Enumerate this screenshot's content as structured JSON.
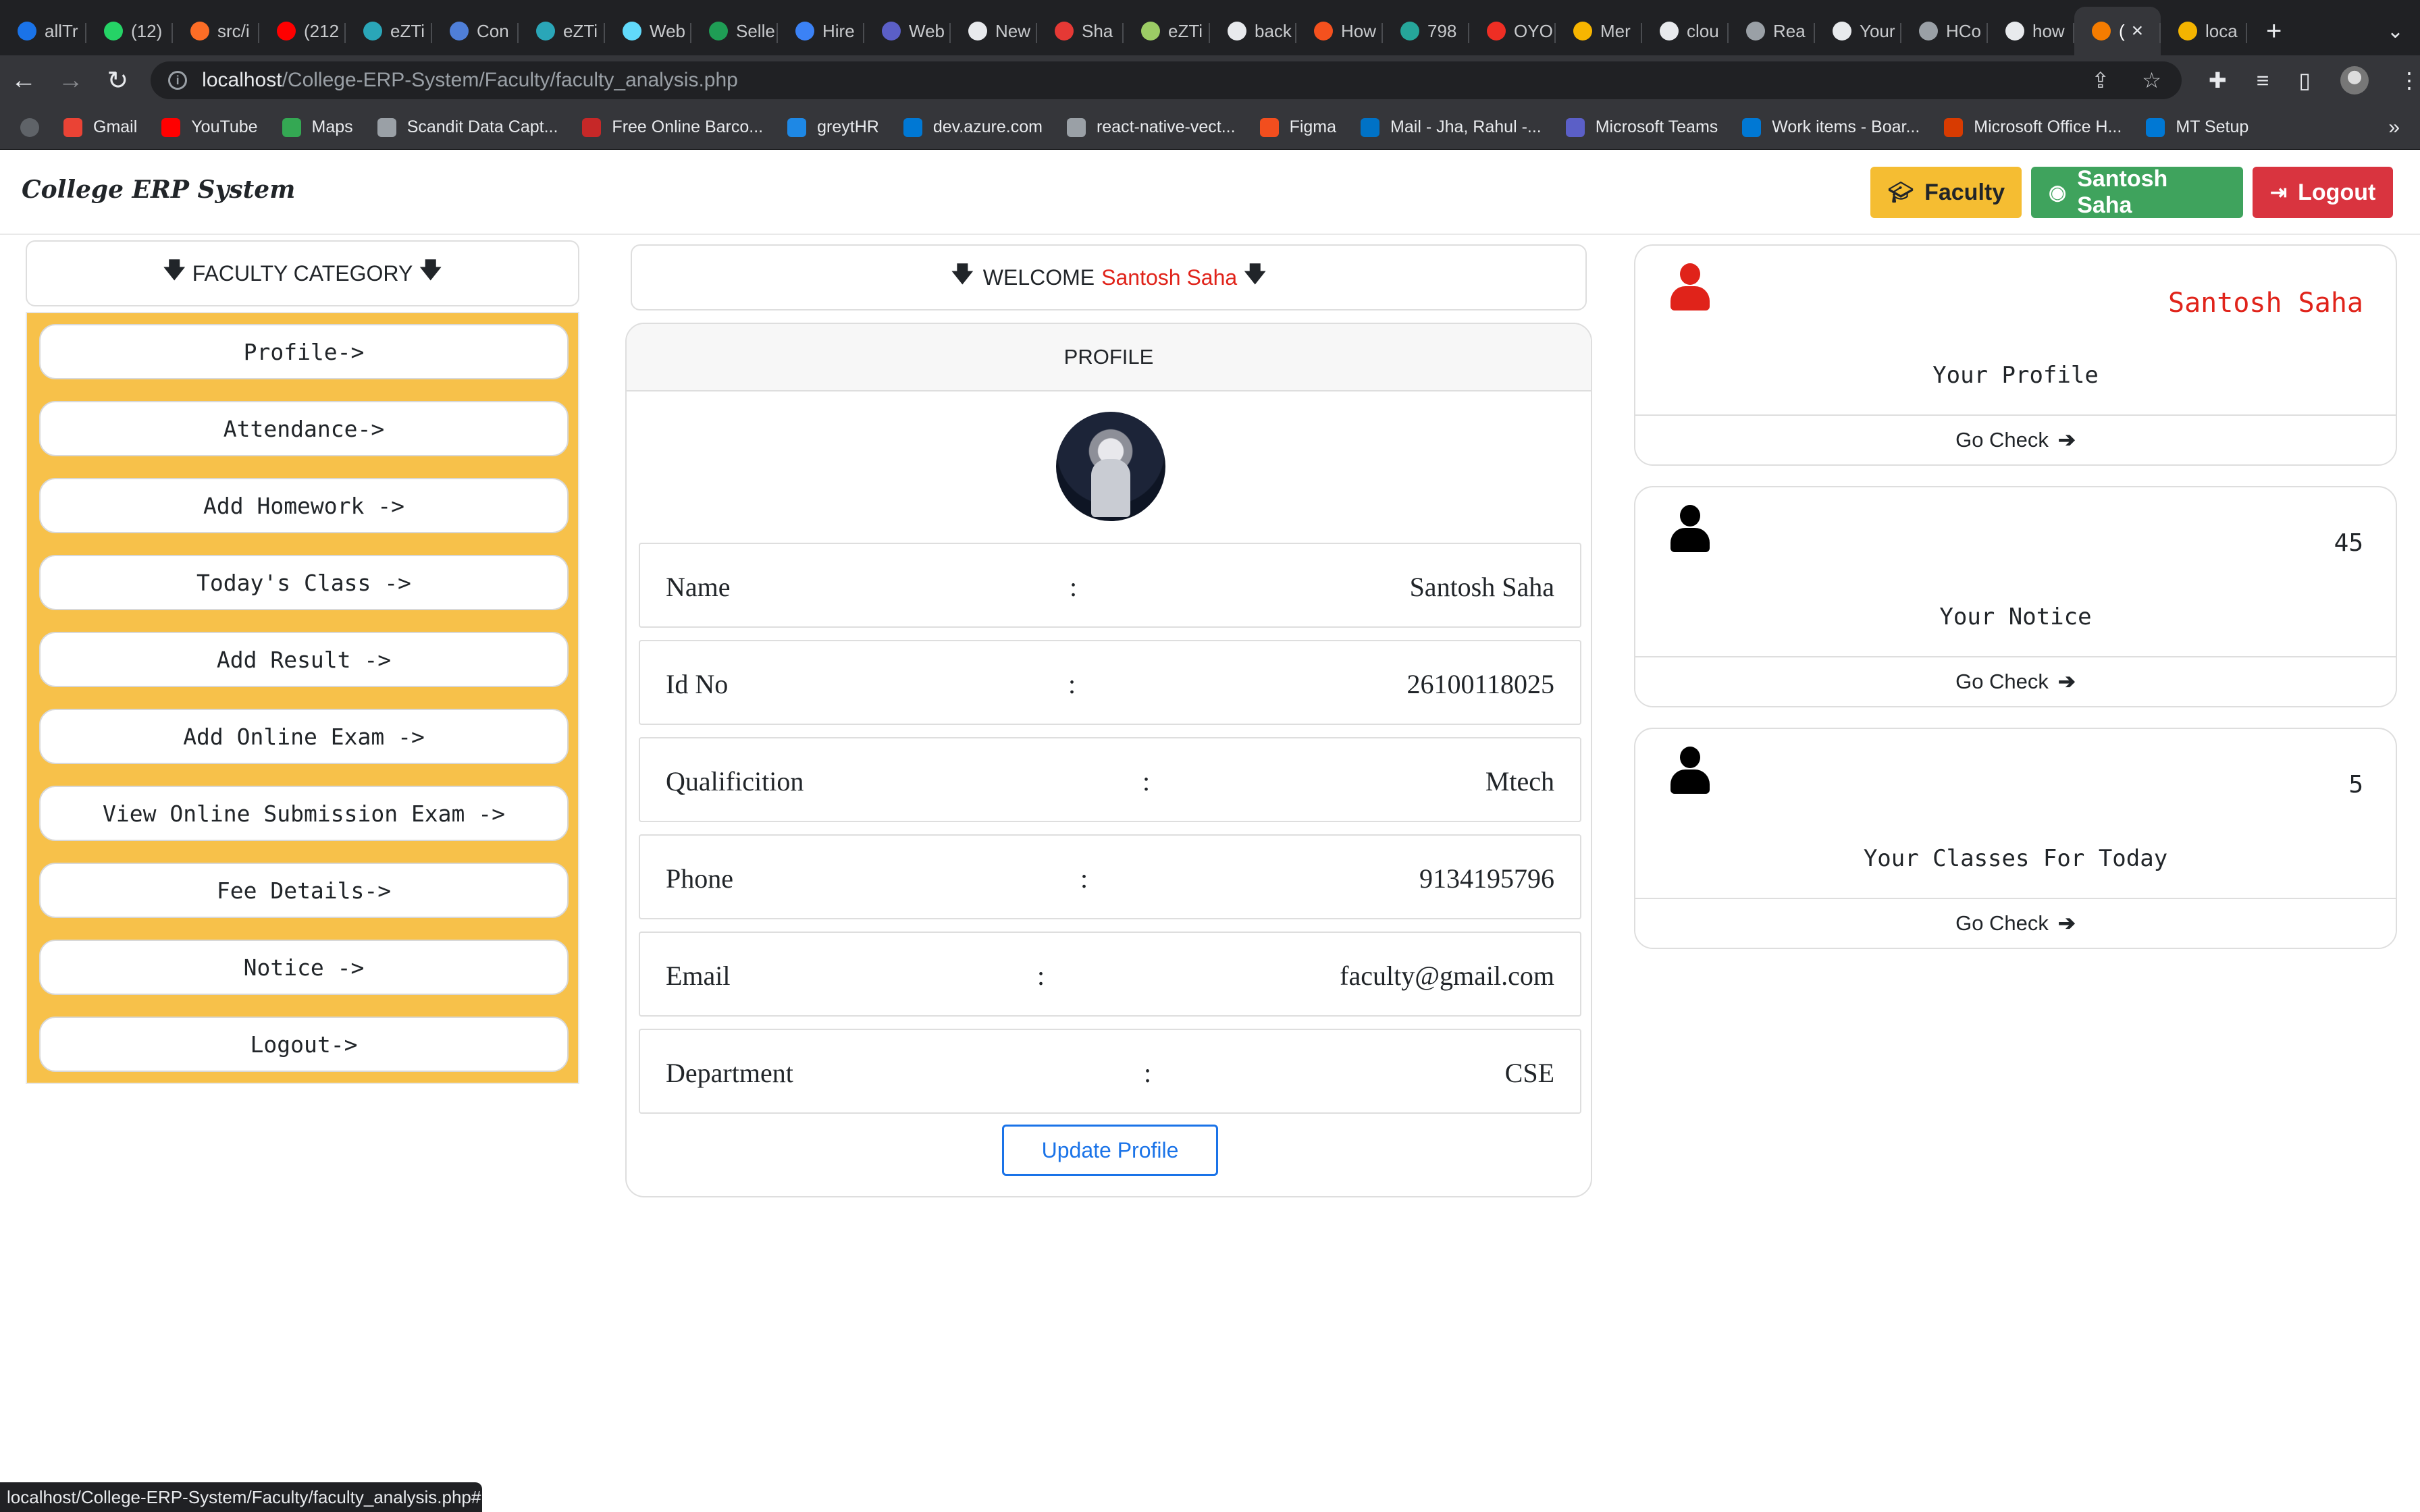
{
  "browser": {
    "tabs": [
      {
        "label": "allTr",
        "color": "#1a73e8"
      },
      {
        "label": "(12)",
        "color": "#25d366"
      },
      {
        "label": "src/i",
        "color": "#fc6d26"
      },
      {
        "label": "(212",
        "color": "#ff0000"
      },
      {
        "label": "eZTi",
        "color": "#2aa6b8"
      },
      {
        "label": "Con",
        "color": "#4f7fd8"
      },
      {
        "label": "eZTi",
        "color": "#2aa6b8"
      },
      {
        "label": "Web",
        "color": "#61dafb"
      },
      {
        "label": "Selle",
        "color": "#1f9d55"
      },
      {
        "label": "Hire",
        "color": "#3b82f6"
      },
      {
        "label": "Web",
        "color": "#5b5fc7"
      },
      {
        "label": "New",
        "color": "#e8eaed"
      },
      {
        "label": "Sha",
        "color": "#e53935"
      },
      {
        "label": "eZTi",
        "color": "#9ccc65"
      },
      {
        "label": "back",
        "color": "#e8eaed"
      },
      {
        "label": "How",
        "color": "#f4511e"
      },
      {
        "label": "798",
        "color": "#26a69a"
      },
      {
        "label": "OYO",
        "color": "#ee2e24"
      },
      {
        "label": "Mer",
        "color": "#f7b500"
      },
      {
        "label": "clou",
        "color": "#e8eaed"
      },
      {
        "label": "Rea",
        "color": "#9aa0a6"
      },
      {
        "label": "Your",
        "color": "#e8eaed"
      },
      {
        "label": "HCo",
        "color": "#9aa0a6"
      },
      {
        "label": "how",
        "color": "#e8eaed"
      },
      {
        "label": "(",
        "color": "#f57c00",
        "active": true
      },
      {
        "label": "loca",
        "color": "#f4b400"
      }
    ],
    "url_host": "localhost",
    "url_path": "/College-ERP-System/Faculty/faculty_analysis.php",
    "bookmarks": [
      {
        "label": "Gmail",
        "color": "#ea4335"
      },
      {
        "label": "YouTube",
        "color": "#ff0000"
      },
      {
        "label": "Maps",
        "color": "#34a853"
      },
      {
        "label": "Scandit Data Capt...",
        "color": "#9aa0a6"
      },
      {
        "label": "Free Online Barco...",
        "color": "#c62828"
      },
      {
        "label": "greytHR",
        "color": "#1e88e5"
      },
      {
        "label": "dev.azure.com",
        "color": "#0078d4"
      },
      {
        "label": "react-native-vect...",
        "color": "#9aa0a6"
      },
      {
        "label": "Figma",
        "color": "#f24e1e"
      },
      {
        "label": "Mail - Jha, Rahul -...",
        "color": "#0072c6"
      },
      {
        "label": "Microsoft Teams",
        "color": "#5b5fc7"
      },
      {
        "label": "Work items - Boar...",
        "color": "#0078d4"
      },
      {
        "label": "Microsoft Office H...",
        "color": "#d83b01"
      },
      {
        "label": "MT Setup",
        "color": "#0078d4"
      }
    ],
    "bookmarks_more": "»",
    "status_url": "localhost/College-ERP-System/Faculty/faculty_analysis.php#"
  },
  "header": {
    "brand": "College ERP System",
    "faculty_btn": "Faculty",
    "user_btn": "Santosh Saha",
    "logout_btn": "Logout"
  },
  "sidebar": {
    "heading": "FACULTY CATEGORY",
    "items": [
      "Profile->",
      "Attendance->",
      "Add Homework ->",
      "Today's Class ->",
      "Add Result ->",
      "Add Online Exam ->",
      "View Online Submission Exam ->",
      "Fee Details->",
      "Notice ->",
      "Logout->"
    ]
  },
  "welcome": {
    "prefix": "WELCOME",
    "name": "Santosh Saha"
  },
  "profile": {
    "heading": "PROFILE",
    "fields": [
      {
        "label": "Name",
        "value": "Santosh Saha"
      },
      {
        "label": "Id No",
        "value": "26100118025"
      },
      {
        "label": "Qualificition",
        "value": "Mtech"
      },
      {
        "label": "Phone",
        "value": "9134195796"
      },
      {
        "label": "Email",
        "value": "faculty@gmail.com"
      },
      {
        "label": "Department",
        "value": "CSE"
      }
    ],
    "separator": ":",
    "update_btn": "Update Profile"
  },
  "cards": [
    {
      "value": "Santosh Saha",
      "label": "Your Profile",
      "link": "Go Check",
      "icon_color": "#e0231a"
    },
    {
      "value": "45",
      "label": "Your Notice",
      "link": "Go Check",
      "icon_color": "#000000"
    },
    {
      "value": "5",
      "label": "Your Classes For Today",
      "link": "Go Check",
      "icon_color": "#000000"
    }
  ]
}
